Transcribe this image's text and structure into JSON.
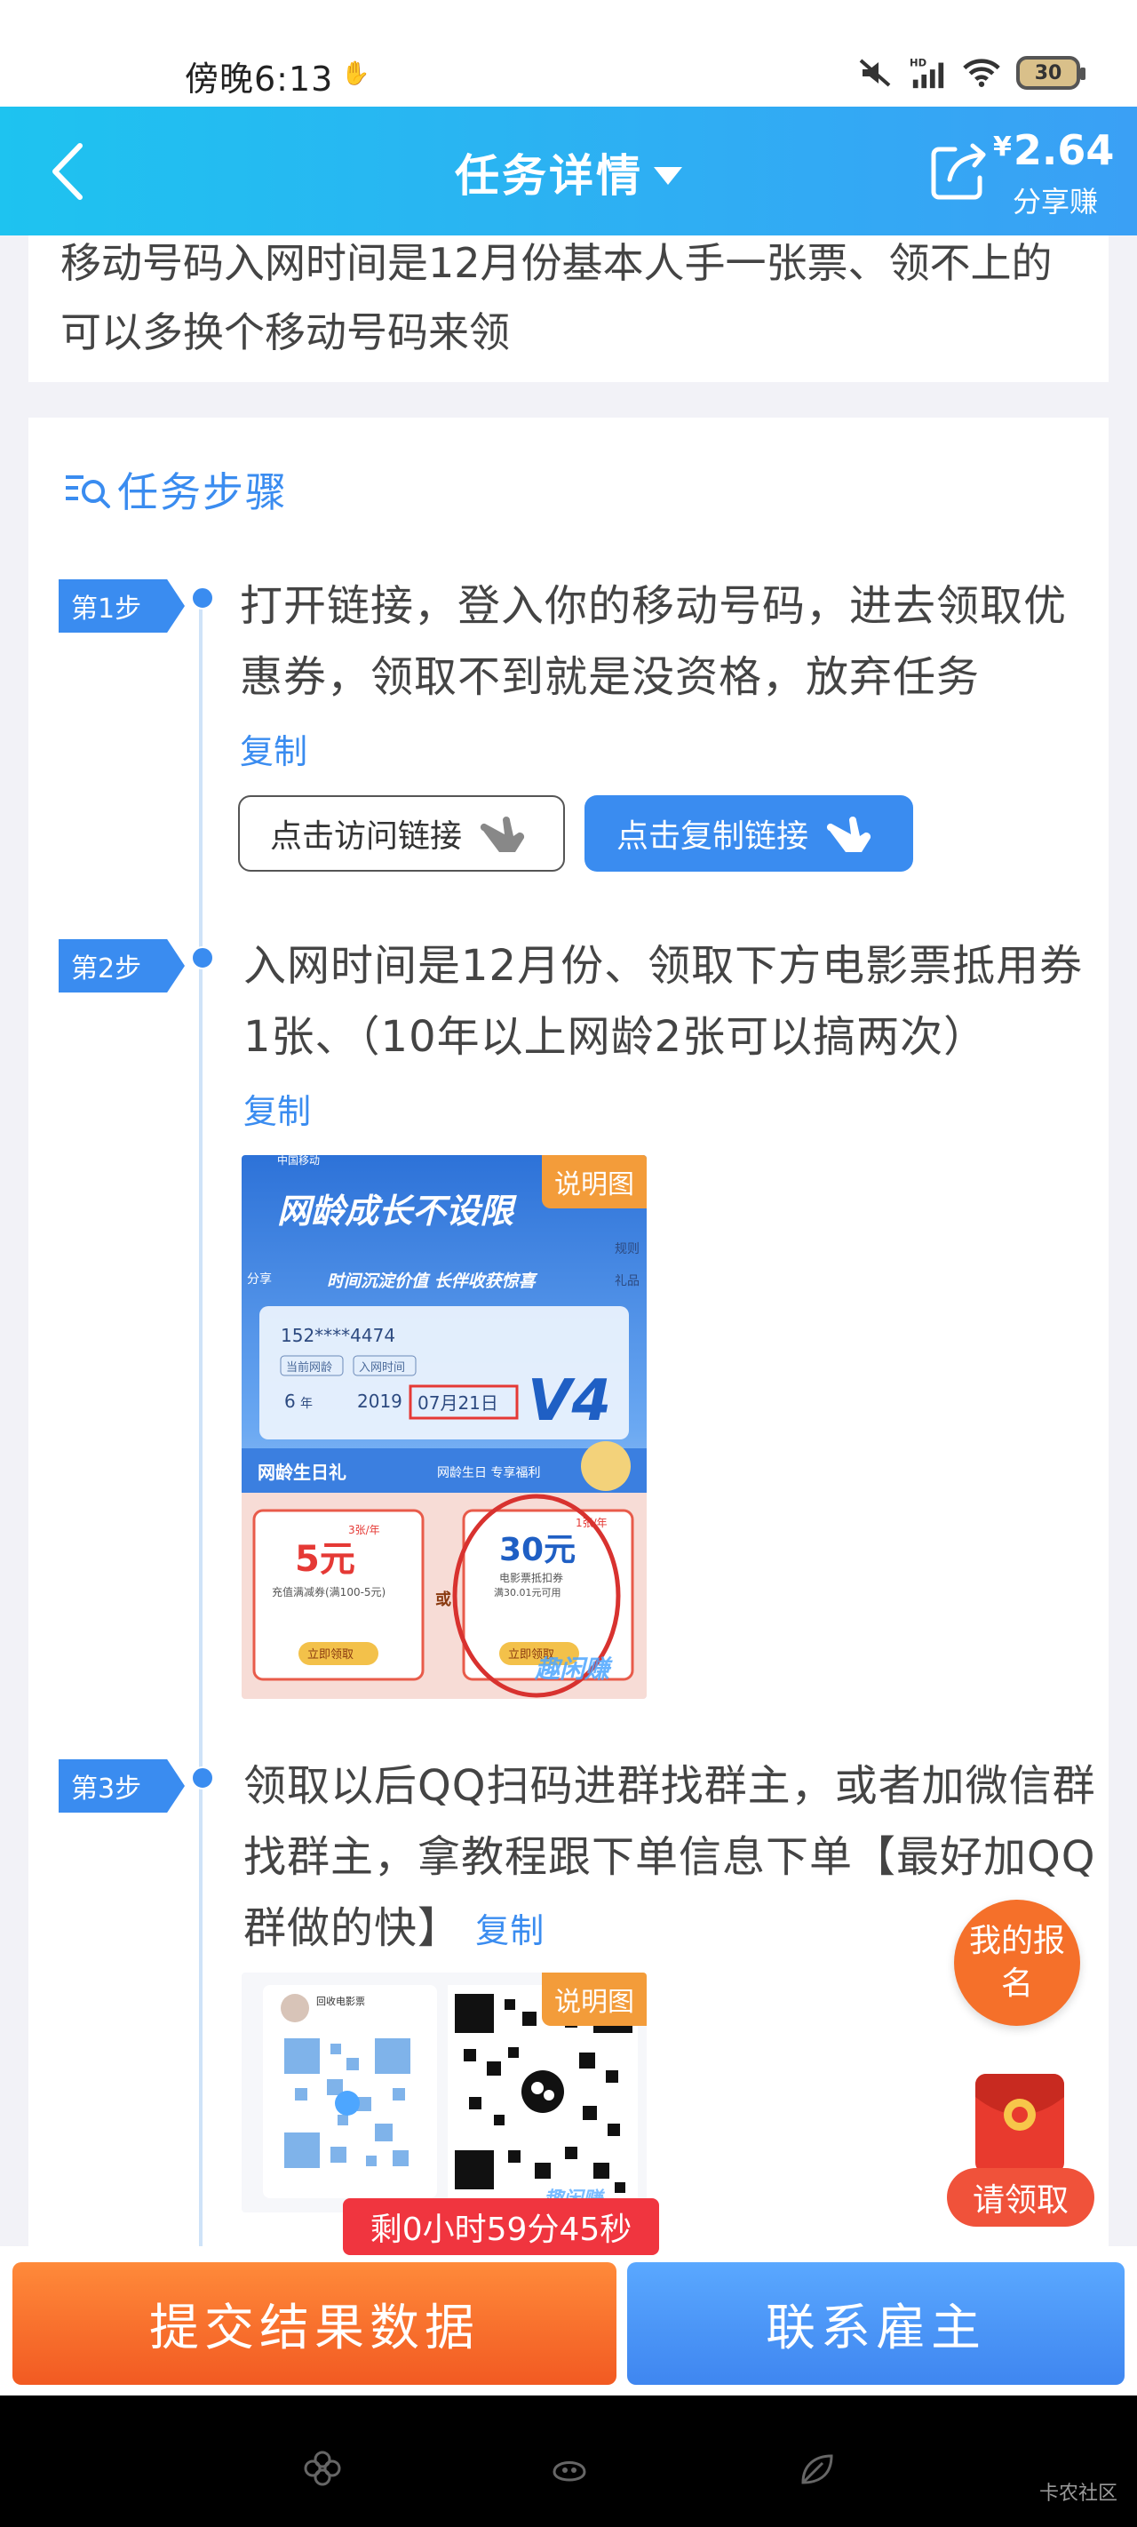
{
  "status_bar": {
    "time": "傍晚6:13",
    "time_emoji_icon": "hand-icon",
    "network": "HD",
    "battery": "30"
  },
  "header": {
    "title": "任务详情",
    "share_currency": "¥",
    "share_amount": "2.64",
    "share_label": "分享赚"
  },
  "notice": {
    "text": "移动号码入网时间是12月份基本人手一张票、领不上的可以多换个移动号码来领"
  },
  "steps_section": {
    "title": "任务步骤",
    "steps": [
      {
        "badge": "第1步",
        "text": "打开链接，登入你的移动号码，进去领取优惠券，领取不到就是没资格，放弃任务",
        "copy_label": "复制",
        "visit_button": "点击访问链接",
        "copy_link_button": "点击复制链接"
      },
      {
        "badge": "第2步",
        "text": "入网时间是12月份、领取下方电影票抵用券1张、（10年以上网龄2张可以搞两次）",
        "copy_label": "复制",
        "image_tag": "说明图",
        "image": {
          "brand": "中国移动",
          "banner": "网龄成长不设限",
          "share": "分享",
          "slogan": "时间沉淀价值 长伴收获惊喜",
          "phone": "152****4474",
          "label_age": "当前网龄",
          "label_join": "入网时间",
          "age": "6",
          "age_unit": "年",
          "year": "2019",
          "date": "07月21日",
          "level": "V4",
          "birthday": "网龄生日礼",
          "benefit": "网龄生日 专享福利",
          "coupon1_amount": "5元",
          "coupon1_freq": "3张/年",
          "coupon1_desc": "充值满减券(满100-5元)",
          "or": "或",
          "coupon2_amount": "30元",
          "coupon2_freq": "1张/年",
          "coupon2_desc": "电影票抵扣券",
          "coupon2_cond": "满30.01元可用",
          "claim": "立即领取",
          "watermark": "趣闲赚",
          "side1": "规则",
          "side2": "礼品"
        }
      },
      {
        "badge": "第3步",
        "text": "领取以后QQ扫码进群找群主，或者加微信群找群主，拿教程跟下单信息下单【最好加QQ群做的快】",
        "copy_label": "复制",
        "image_tag": "说明图",
        "image": {
          "group_name": "回收电影票",
          "watermark": "趣闲赚"
        }
      }
    ]
  },
  "float": {
    "signup": "我的报名",
    "claim": "请领取"
  },
  "timer": "剩0小时59分45秒",
  "bottom": {
    "submit": "提交结果数据",
    "contact": "联系雇主"
  },
  "nav_watermark": "卡农社区",
  "colors": {
    "accent": "#3a8cf0",
    "header_start": "#1ec3f0",
    "submit": "#f25a22",
    "timer": "#f0353f"
  }
}
